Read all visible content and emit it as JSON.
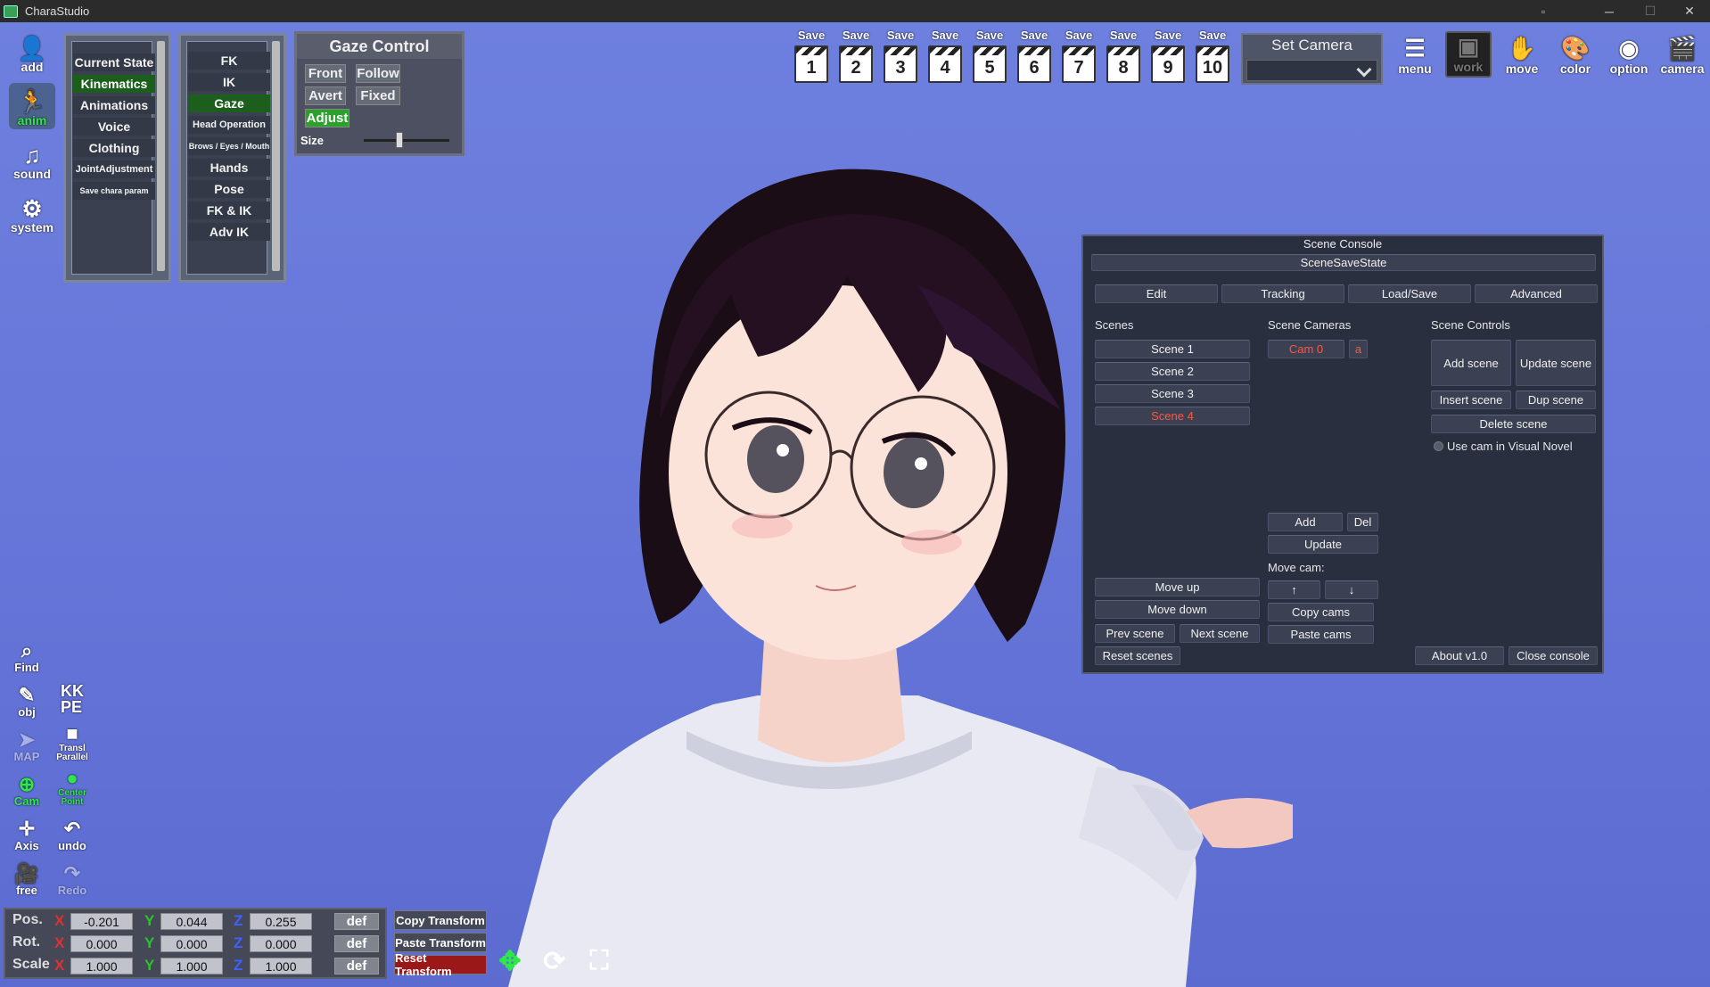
{
  "window": {
    "title": "CharaStudio",
    "controls": [
      "▫",
      "─",
      "☐",
      "✕"
    ]
  },
  "left_sidebar": [
    {
      "label": "add",
      "icon": "person-add-icon",
      "glyph": "👤"
    },
    {
      "label": "anim",
      "icon": "running-figure-icon",
      "glyph": "🏃"
    },
    {
      "label": "sound",
      "icon": "music-note-icon",
      "glyph": "♫"
    },
    {
      "label": "system",
      "icon": "gears-icon",
      "glyph": "⚙"
    }
  ],
  "menu_panel_1": {
    "items": [
      "Current State",
      "Kinematics",
      "Animations",
      "Voice",
      "Clothing",
      "JointAdjustment",
      "Save chara param"
    ],
    "active": "Kinematics"
  },
  "menu_panel_2": {
    "items": [
      "FK",
      "IK",
      "Gaze",
      "Head Operation",
      "Brows / Eyes / Mouth",
      "Hands",
      "Pose",
      "FK & IK",
      "Adv IK"
    ],
    "active": "Gaze"
  },
  "gaze_control": {
    "title": "Gaze Control",
    "buttons": [
      "Front",
      "Follow",
      "Avert",
      "Fixed",
      "Adjust"
    ],
    "active": "Adjust",
    "size_label": "Size",
    "size_value": 0.42
  },
  "save_slots": {
    "save_label": "Save",
    "numbers": [
      "1",
      "2",
      "3",
      "4",
      "5",
      "6",
      "7",
      "8",
      "9",
      "10"
    ]
  },
  "set_camera": {
    "title": "Set Camera",
    "value": ""
  },
  "top_icons": [
    {
      "label": "menu",
      "icon": "menu-list-icon",
      "glyph": "☰"
    },
    {
      "label": "work",
      "icon": "work-window-icon",
      "glyph": "▣"
    },
    {
      "label": "move",
      "icon": "hand-move-icon",
      "glyph": "✋"
    },
    {
      "label": "color",
      "icon": "palette-icon",
      "glyph": "🎨"
    },
    {
      "label": "option",
      "icon": "eye-option-icon",
      "glyph": "◉"
    },
    {
      "label": "camera",
      "icon": "clapper-camera-icon",
      "glyph": "🎬"
    }
  ],
  "tools": {
    "find": "Find",
    "obj": "obj",
    "kkpe": "KK\nPE",
    "map": "MAP",
    "transl": "Transl\nParallel",
    "cam": "Cam",
    "center": "Center\nPoint",
    "axis": "Axis",
    "undo": "undo",
    "free": "free",
    "redo": "Redo"
  },
  "transform": {
    "rows": [
      {
        "label": "Pos.",
        "x": "-0.201",
        "y": "0.044",
        "z": "0.255"
      },
      {
        "label": "Rot.",
        "x": "0.000",
        "y": "0.000",
        "z": "0.000"
      },
      {
        "label": "Scale",
        "x": "1.000",
        "y": "1.000",
        "z": "1.000"
      }
    ],
    "axis_labels": [
      "X",
      "Y",
      "Z"
    ],
    "def_label": "def",
    "copy": "Copy Transform",
    "paste": "Paste Transform",
    "reset": "Reset Transform"
  },
  "scene_console": {
    "title": "Scene Console",
    "subtitle": "SceneSaveState",
    "tabs": [
      "Edit",
      "Tracking",
      "Load/Save",
      "Advanced"
    ],
    "scenes_label": "Scenes",
    "scenes": [
      "Scene 1",
      "Scene 2",
      "Scene 3",
      "Scene 4"
    ],
    "active_scene": "Scene 4",
    "cameras_label": "Scene Cameras",
    "camera": "Cam 0",
    "camera_a": "a",
    "controls_label": "Scene Controls",
    "add_scene": "Add scene",
    "update_scene": "Update scene",
    "insert_scene": "Insert scene",
    "dup_scene": "Dup scene",
    "delete_scene": "Delete scene",
    "use_cam_vn": "Use cam in Visual Novel",
    "cam_add": "Add",
    "cam_del": "Del",
    "cam_update": "Update",
    "move_cam": "Move cam:",
    "up_arrow": "↑",
    "down_arrow": "↓",
    "copy_cams": "Copy cams",
    "paste_cams": "Paste cams",
    "move_up": "Move up",
    "move_down": "Move down",
    "prev_scene": "Prev scene",
    "next_scene": "Next scene",
    "reset_scenes": "Reset scenes",
    "about": "About v1.0",
    "close": "Close console"
  },
  "colors": {
    "accent_green": "#1c5e1c",
    "active_green": "#29a12a",
    "red_text": "#ff5640",
    "reset_red": "#9b1818",
    "sky": "#6676d9"
  }
}
